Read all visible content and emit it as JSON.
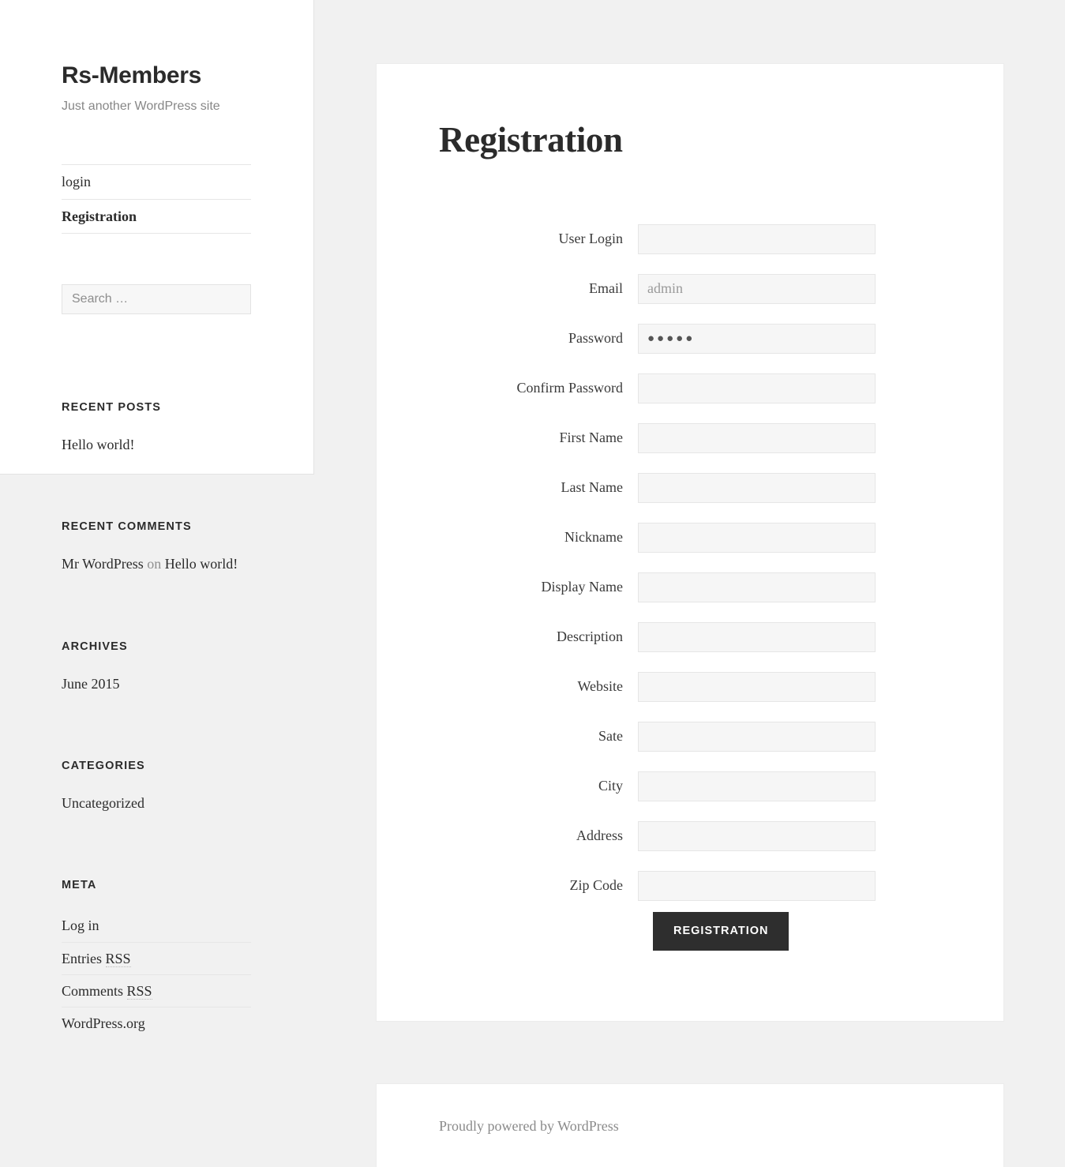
{
  "site": {
    "title": "Rs-Members",
    "tagline": "Just another WordPress site"
  },
  "nav": {
    "items": [
      {
        "label": "login",
        "current": false
      },
      {
        "label": "Registration",
        "current": true
      }
    ]
  },
  "search": {
    "placeholder": "Search …",
    "value": ""
  },
  "widgets": {
    "recent_posts": {
      "title": "Recent Posts",
      "items": [
        "Hello world!"
      ]
    },
    "recent_comments": {
      "title": "Recent Comments",
      "author": "Mr WordPress",
      "connector": "on",
      "post": "Hello world!"
    },
    "archives": {
      "title": "Archives",
      "items": [
        "June 2015"
      ]
    },
    "categories": {
      "title": "Categories",
      "items": [
        "Uncategorized"
      ]
    },
    "meta": {
      "title": "Meta",
      "items": [
        "Log in",
        "Entries RSS",
        "Comments RSS",
        "WordPress.org"
      ],
      "login_label": "Log in",
      "entries_prefix": "Entries ",
      "comments_prefix": "Comments ",
      "rss_label": "RSS",
      "wporg_label": "WordPress.org"
    }
  },
  "main": {
    "page_title": "Registration",
    "form": {
      "fields": [
        {
          "label": "User Login",
          "value": "",
          "type": "text",
          "placeholder": ""
        },
        {
          "label": "Email",
          "value": "admin",
          "type": "text",
          "placeholder": ""
        },
        {
          "label": "Password",
          "value": "●●●●●",
          "type": "password",
          "placeholder": ""
        },
        {
          "label": "Confirm Password",
          "value": "",
          "type": "password",
          "placeholder": ""
        },
        {
          "label": "First Name",
          "value": "",
          "type": "text",
          "placeholder": ""
        },
        {
          "label": "Last Name",
          "value": "",
          "type": "text",
          "placeholder": ""
        },
        {
          "label": "Nickname",
          "value": "",
          "type": "text",
          "placeholder": ""
        },
        {
          "label": "Display Name",
          "value": "",
          "type": "text",
          "placeholder": ""
        },
        {
          "label": "Description",
          "value": "",
          "type": "text",
          "placeholder": ""
        },
        {
          "label": "Website",
          "value": "",
          "type": "text",
          "placeholder": ""
        },
        {
          "label": "Sate",
          "value": "",
          "type": "text",
          "placeholder": ""
        },
        {
          "label": "City",
          "value": "",
          "type": "text",
          "placeholder": ""
        },
        {
          "label": "Address",
          "value": "",
          "type": "text",
          "placeholder": ""
        },
        {
          "label": "Zip Code",
          "value": "",
          "type": "text",
          "placeholder": ""
        }
      ],
      "submit_label": "Registration"
    }
  },
  "footer": {
    "credit_prefix": "Proudly powered by ",
    "credit_link": "WordPress"
  },
  "colors": {
    "page_background": "#f1f1f1",
    "panel_background": "#ffffff",
    "text": "#2b2b2b",
    "muted_text": "#8a8a8a",
    "input_background": "#f6f6f6",
    "input_border": "#e6e6e6",
    "button_background": "#2e2e2e",
    "button_text": "#ffffff"
  }
}
